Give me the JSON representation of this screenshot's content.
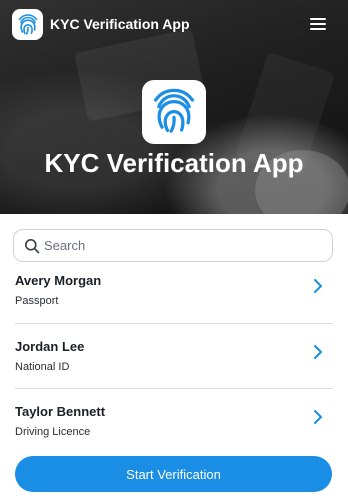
{
  "header": {
    "app_title": "KYC Verification App",
    "logo_icon": "fingerprint-icon",
    "menu_icon": "hamburger-menu-icon"
  },
  "hero": {
    "title": "KYC Verification App",
    "logo_icon": "fingerprint-icon"
  },
  "search": {
    "placeholder": "Search",
    "value": "",
    "icon": "search-icon"
  },
  "records": [
    {
      "name": "Avery Morgan",
      "document": "Passport"
    },
    {
      "name": "Jordan Lee",
      "document": "National ID"
    },
    {
      "name": "Taylor Bennett",
      "document": "Driving Licence"
    }
  ],
  "actions": {
    "start_label": "Start Verification"
  },
  "colors": {
    "accent": "#1a8ee5",
    "fingerprint": "#1d8ee6",
    "text": "#1c1f24",
    "divider": "#d9dce0"
  }
}
